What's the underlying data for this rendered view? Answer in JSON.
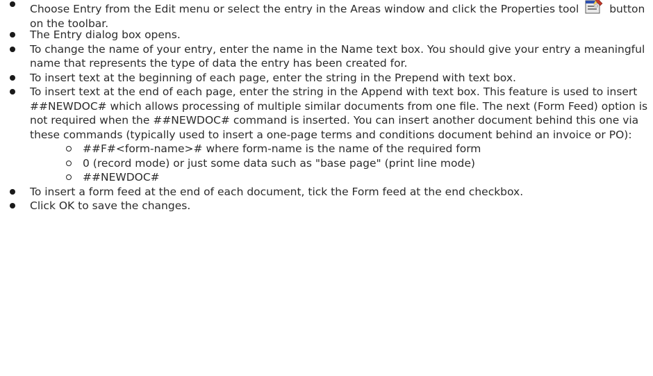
{
  "items": [
    {
      "text_before": "Choose Entry from the Edit menu or select the entry in the Areas window and click the Properties tool",
      "text_after": "button on the toolbar.",
      "icon": "properties-tool-icon"
    },
    {
      "text": "The Entry dialog box opens."
    },
    {
      "text": "To change the name of your entry, enter the name in the Name text box. You should give your entry a meaningful name that represents the type of data the entry has been created for."
    },
    {
      "text": "To insert text at the beginning of each page, enter the string in the Prepend with text box."
    },
    {
      "text": "To insert text at the end of each page, enter the string in the Append with text box. This feature is used to insert ##NEWDOC# which allows processing of multiple similar documents from one file. The next (Form Feed) option is not required when the ##NEWDOC# command is inserted. You can insert another document behind this one via these commands (typically used to insert a one-page terms and conditions document behind an invoice or PO):",
      "subitems": [
        "##F#<form-name># where form-name is the name of the required form",
        "0 (record mode) or just some data such as \"base page\" (print line mode)",
        "##NEWDOC#"
      ]
    },
    {
      "text": "To insert a form feed at the end of each document, tick the Form feed at the end checkbox."
    },
    {
      "text": "Click OK to save the changes."
    }
  ]
}
